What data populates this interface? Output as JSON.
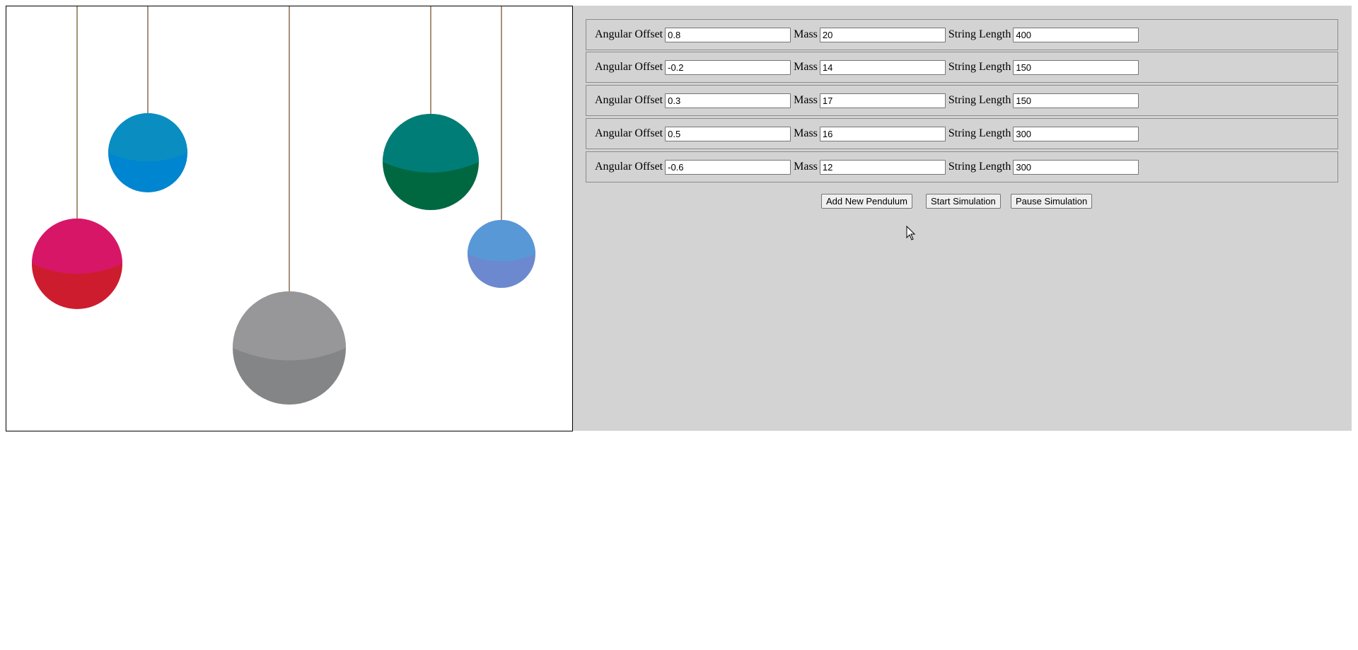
{
  "canvas": {
    "pendulums": [
      {
        "color_top": "#d81667",
        "color_bottom": "#cd1c2e"
      },
      {
        "color_top": "#0a8ec1",
        "color_bottom": "#0085d0"
      },
      {
        "color_top": "#97979a",
        "color_bottom": "#848587"
      },
      {
        "color_top": "#007d77",
        "color_bottom": "#006841"
      },
      {
        "color_top": "#5898d6",
        "color_bottom": "#6c89cf"
      }
    ],
    "string_color": "#8b6b4a"
  },
  "controls": {
    "labels": {
      "angular_offset": "Angular Offset",
      "mass": "Mass",
      "string_length": "String Length"
    },
    "rows": [
      {
        "angular_offset": "0.8",
        "mass": "20",
        "string_length": "400"
      },
      {
        "angular_offset": "-0.2",
        "mass": "14",
        "string_length": "150"
      },
      {
        "angular_offset": "0.3",
        "mass": "17",
        "string_length": "150"
      },
      {
        "angular_offset": "0.5",
        "mass": "16",
        "string_length": "300"
      },
      {
        "angular_offset": "-0.6",
        "mass": "12",
        "string_length": "300"
      }
    ],
    "buttons": {
      "add": "Add New Pendulum",
      "start": "Start Simulation",
      "pause": "Pause Simulation"
    }
  }
}
